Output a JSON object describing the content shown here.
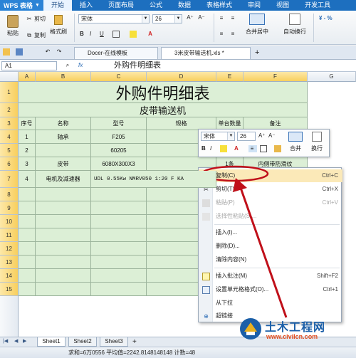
{
  "titlebar": {
    "app_name": "WPS 表格",
    "tabs": [
      "开始",
      "插入",
      "页面布局",
      "公式",
      "数据",
      "表格样式",
      "审阅",
      "视图",
      "开发工具"
    ]
  },
  "ribbon": {
    "paste": "粘贴",
    "cut": "剪切",
    "copy": "复制",
    "format_painter": "格式刷",
    "font": "宋体",
    "size": "26",
    "bold": "B",
    "italic": "I",
    "underline": "U",
    "merge_center": "合并居中",
    "wrap": "自动换行"
  },
  "doc_tabs": [
    {
      "label": "Docer-在线模板"
    },
    {
      "label": "3米皮带输送机.xls *"
    }
  ],
  "formula": {
    "cell_ref": "A1",
    "fx": "fx",
    "value": "外购件明细表"
  },
  "columns": [
    "A",
    "B",
    "C",
    "D",
    "E",
    "F",
    "G"
  ],
  "rows": [
    "1",
    "2",
    "3",
    "4",
    "5",
    "6",
    "7",
    "8",
    "9",
    "10",
    "11",
    "12",
    "13",
    "14",
    "15"
  ],
  "sheet": {
    "title": "外购件明细表",
    "subtitle": "皮带输送机",
    "headers": [
      "序号",
      "名称",
      "型号",
      "规格",
      "单台数量",
      "备注"
    ],
    "data_rows": [
      [
        "1",
        "轴承",
        "F205",
        "",
        "",
        ""
      ],
      [
        "2",
        "",
        "60205",
        "",
        "",
        ""
      ],
      [
        "3",
        "皮带",
        "6080X300X3",
        "",
        "1条",
        "内侧带防滑纹"
      ],
      [
        "4",
        "电机及减速器",
        "UDL 0.55Kw NMRV050 1:20 F KA",
        "",
        "",
        ""
      ]
    ]
  },
  "mini_toolbar": {
    "font": "宋体",
    "size": "26",
    "merge": "合并",
    "wrap": "换行"
  },
  "context_menu": [
    {
      "label": "复制(C)",
      "shortcut": "Ctrl+C",
      "icon": "copy-icon",
      "state": "highlight"
    },
    {
      "label": "剪切(T)",
      "shortcut": "Ctrl+X",
      "icon": "scissors-icon",
      "state": "normal"
    },
    {
      "label": "粘贴(P)",
      "shortcut": "Ctrl+V",
      "icon": "paste-icon",
      "state": "disabled"
    },
    {
      "label": "选择性粘贴(S)...",
      "shortcut": "",
      "icon": "paste-special-icon",
      "state": "disabled"
    },
    {
      "label": "插入(I)...",
      "shortcut": "",
      "icon": "",
      "state": "normal"
    },
    {
      "label": "删除(D)...",
      "shortcut": "",
      "icon": "",
      "state": "normal"
    },
    {
      "label": "清除内容(N)",
      "shortcut": "",
      "icon": "",
      "state": "normal"
    },
    {
      "label": "插入批注(M)",
      "shortcut": "Shift+F2",
      "icon": "comment-icon",
      "state": "normal"
    },
    {
      "label": "设置单元格格式(O)...",
      "shortcut": "Ctrl+1",
      "icon": "format-cells-icon",
      "state": "normal"
    },
    {
      "label": "从下拉",
      "shortcut": "",
      "icon": "",
      "state": "normal"
    },
    {
      "label": "超链接",
      "shortcut": "",
      "icon": "link-icon",
      "state": "normal"
    }
  ],
  "sheet_tabs": [
    "Sheet1",
    "Sheet2",
    "Sheet3"
  ],
  "status": {
    "text": "求和=6万0556  平均值=2242.8148148148  计数=48"
  },
  "watermark": {
    "title": "土木工程网",
    "url": "www.civilcn.com"
  },
  "colors": {
    "accent": "#1d6fbf",
    "highlight_ring": "#c0101a",
    "cell_fill": "#dcefd6"
  }
}
